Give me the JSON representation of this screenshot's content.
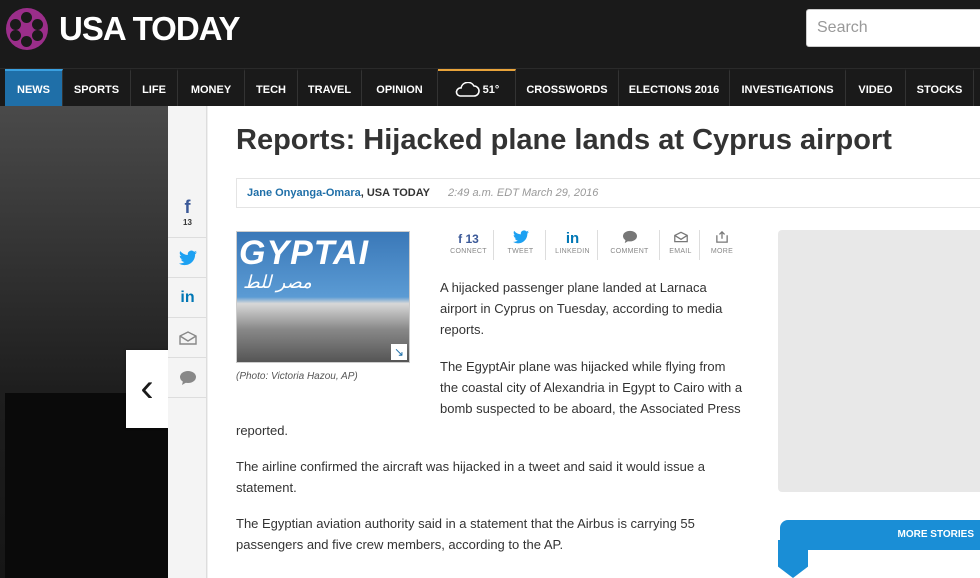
{
  "header": {
    "logo_text": "USA TODAY",
    "search_placeholder": "Search"
  },
  "nav": {
    "items": [
      {
        "label": "NEWS"
      },
      {
        "label": "SPORTS"
      },
      {
        "label": "LIFE"
      },
      {
        "label": "MONEY"
      },
      {
        "label": "TECH"
      },
      {
        "label": "TRAVEL"
      },
      {
        "label": "OPINION"
      },
      {
        "label": "51°"
      },
      {
        "label": "CROSSWORDS"
      },
      {
        "label": "ELECTIONS 2016"
      },
      {
        "label": "INVESTIGATIONS"
      },
      {
        "label": "VIDEO"
      },
      {
        "label": "STOCKS"
      }
    ],
    "active": "NEWS"
  },
  "rail": {
    "facebook_count": "13"
  },
  "article": {
    "headline": "Reports: Hijacked plane lands at Cyprus airport",
    "author": "Jane Onyanga-Omara",
    "outlet": ", USA TODAY",
    "timestamp": "2:49 a.m. EDT March 29, 2016",
    "photo_brand": "GYPTAI",
    "photo_arabic": "مصر للط",
    "photo_caption": "(Photo: Victoria Hazou, AP)",
    "share": [
      {
        "icon": "f 13",
        "label": "CONNECT"
      },
      {
        "icon": "🐦",
        "label": "TWEET"
      },
      {
        "icon": "in",
        "label": "LINKEDIN"
      },
      {
        "icon": "💬",
        "label": "COMMENT"
      },
      {
        "icon": "✉",
        "label": "EMAIL"
      },
      {
        "icon": "↗",
        "label": "MORE"
      }
    ],
    "p1_lines": [
      "A hijacked passenger plane landed at Larnaca",
      "airport in Cyprus on Tuesday, according to media",
      "reports."
    ],
    "p2_lines": [
      "The EgyptAir plane was hijacked while flying from",
      "the coastal city of Alexandria in Egypt to Cairo with a",
      "bomb suspected to be aboard, the Associated Press"
    ],
    "p2_tail": "reported.",
    "p3_lines": [
      "The airline confirmed the aircraft was hijacked in a tweet and said it would issue a",
      "statement."
    ],
    "p4_lines": [
      "The Egyptian aviation authority said in a statement that the Airbus is carrying 55",
      "passengers and five crew members, according to the AP."
    ]
  },
  "right": {
    "more_stories": "MORE STORIES"
  }
}
